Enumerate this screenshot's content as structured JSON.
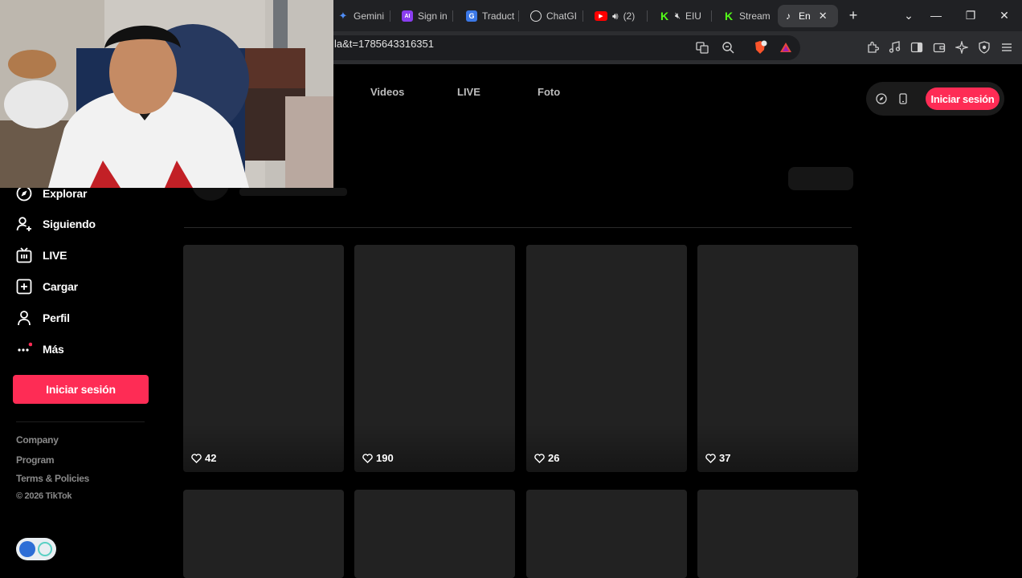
{
  "browser": {
    "tabs": [
      {
        "label": "Gemini",
        "color": "#4f8df5",
        "glyph": "✦"
      },
      {
        "label": "Sign in",
        "color": "#8a3ef0",
        "glyph": "AI"
      },
      {
        "label": "Traduct",
        "color": "#3b78e7",
        "glyph": "G"
      },
      {
        "label": "ChatGI",
        "color": "#5a5a5a",
        "glyph": "◎"
      },
      {
        "label": "(2)",
        "color": "#ff0000",
        "glyph": "▶"
      },
      {
        "label": "EIU",
        "color": "#53fc18",
        "glyph": "K"
      },
      {
        "label": "Stream",
        "color": "#53fc18",
        "glyph": "K"
      },
      {
        "label": "En",
        "color": "#000000",
        "glyph": "♪"
      }
    ],
    "url": "la&t=1785643316351",
    "new_tab": "+",
    "window_controls": {
      "list": "⌄",
      "minimize": "—",
      "restore": "❐",
      "close": "✕"
    }
  },
  "top_nav": {
    "items": [
      "Videos",
      "LIVE",
      "Foto"
    ]
  },
  "header_login": "Iniciar sesión",
  "sidebar": {
    "items": [
      {
        "label": "Explorar",
        "icon": "compass-icon"
      },
      {
        "label": "Siguiendo",
        "icon": "user-follow-icon"
      },
      {
        "label": "LIVE",
        "icon": "live-tv-icon"
      },
      {
        "label": "Cargar",
        "icon": "upload-plus-icon"
      },
      {
        "label": "Perfil",
        "icon": "profile-icon"
      },
      {
        "label": "Más",
        "icon": "more-dots-icon"
      }
    ],
    "login_button": "Iniciar sesión",
    "footer_links": [
      "Company",
      "Program",
      "Terms & Policies"
    ],
    "copyright": "© 2026 TikTok"
  },
  "videos": {
    "row1": [
      {
        "likes": "42"
      },
      {
        "likes": "190"
      },
      {
        "likes": "26"
      },
      {
        "likes": "37"
      }
    ],
    "row2_count": 4
  },
  "colors": {
    "brand": "#fe2c55",
    "card": "#222222",
    "page_bg": "#000000"
  }
}
